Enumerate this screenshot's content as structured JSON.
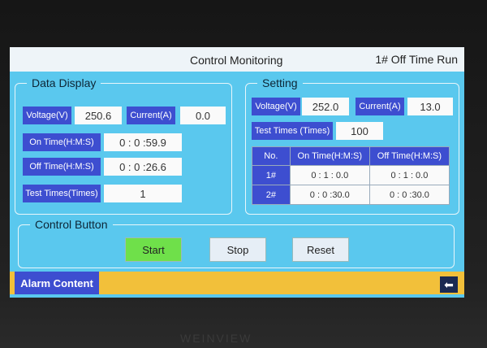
{
  "window": {
    "title": "Control Monitoring",
    "mode": "1# Off Time Run"
  },
  "data_display": {
    "legend": "Data Display",
    "voltage_label": "Voltage(V)",
    "voltage_value": "250.6",
    "current_label": "Current(A)",
    "current_value": "0.0",
    "on_time_label": "On Time(H:M:S)",
    "on_time_value": "0 : 0 :59.9",
    "off_time_label": "Off Time(H:M:S)",
    "off_time_value": "0 : 0 :26.6",
    "test_times_label": "Test Times(Times)",
    "test_times_value": "1"
  },
  "setting": {
    "legend": "Setting",
    "voltage_label": "Voltage(V)",
    "voltage_value": "252.0",
    "current_label": "Current(A)",
    "current_value": "13.0",
    "test_times_label": "Test Times (Times)",
    "test_times_value": "100",
    "table": {
      "headers": [
        "No.",
        "On Time(H:M:S)",
        "Off Time(H:M:S)"
      ],
      "rows": [
        {
          "no": "1#",
          "on": "0 : 1 : 0.0",
          "off": "0 : 1 : 0.0"
        },
        {
          "no": "2#",
          "on": "0 : 0 :30.0",
          "off": "0 : 0 :30.0"
        }
      ]
    }
  },
  "control": {
    "legend": "Control Button",
    "start_label": "Start",
    "stop_label": "Stop",
    "reset_label": "Reset"
  },
  "alarm": {
    "label": "Alarm Content"
  },
  "nav": {
    "back_icon": "back-arrow-icon",
    "back_glyph": "⬅"
  },
  "bezel": {
    "brand": "WEINVIEW"
  },
  "colors": {
    "screen_bg": "#5ac8ee",
    "label_bg": "#3d4ed0",
    "value_bg": "#fafafa",
    "start_bg": "#6fe04a",
    "stop_bg": "#e6eef6",
    "alarm_bar": "#f2c03a"
  }
}
